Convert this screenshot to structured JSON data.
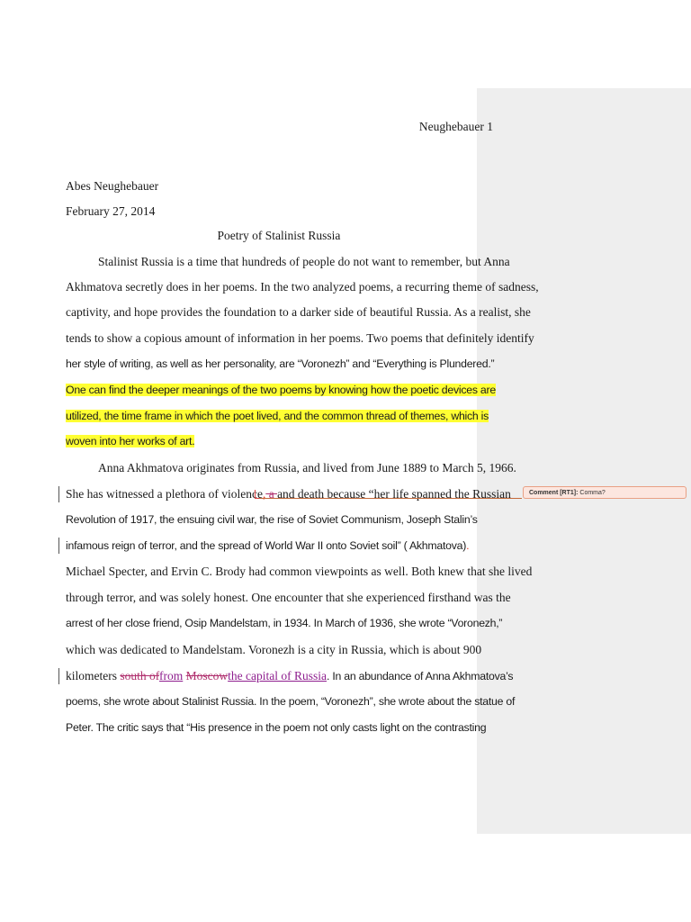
{
  "header": {
    "page_number": "Neughebauer 1"
  },
  "author": "Abes Neughebauer",
  "date": "February 27, 2014",
  "title": "Poetry of Stalinist Russia",
  "p1": {
    "l1": "Stalinist Russia is a time that hundreds of people do not want to remember, but Anna",
    "l2": "Akhmatova secretly does in her poems. In the two analyzed poems, a recurring theme of sadness,",
    "l3": "captivity, and hope provides the foundation to a darker side of beautiful Russia. As a realist, she",
    "l4": "tends to show a copious amount of information in her poems. Two poems that definitely identify",
    "l5": "her style of writing, as well as her personality, are “Voronezh” and “Everything is Plundered.”",
    "l6": "One can find the deeper meanings of the two poems by knowing how the poetic devices are",
    "l7": "utilized, the time frame in which the poet lived, and the common thread of themes, which is",
    "l8": "woven into her works of art."
  },
  "p2": {
    "l1": "Anna Akhmatova originates from Russia, and lived from June 1889 to March 5, 1966.",
    "l2a": "She has witnessed a plethora of violence",
    "l2_mark1": ",",
    "l2_del": " a ",
    "l2b": "and death because “her life spanned the Russian",
    "l3": "Revolution of 1917,  the ensuing civil war, the rise of Soviet Communism, Joseph Stalin’s",
    "l4a": "infamous reign of terror, and the spread of World War II onto Soviet soil” ( Akhmatova)",
    "l4_mark": ".",
    "l5": "Michael Specter, and Ervin C. Brody had common viewpoints as well. Both knew that she lived",
    "l6": "through terror, and was solely honest. One encounter that she experienced firsthand was the",
    "l7": "arrest of her close friend, Osip Mandelstam, in 1934. In March of 1936, she wrote “Voronezh,”",
    "l8": "which was dedicated to Mandelstam.  Voronezh is a city in Russia, which is about 900",
    "l9a": "kilometers ",
    "l9_del1": "south of",
    "l9_ins1": "from",
    "l9_space": " ",
    "l9_del2": "Moscow",
    "l9_ins2": "the capital of Russia",
    "l9b": ". In an abundance of Anna Akhmatova’s",
    "l10": "poems, she wrote about Stalinist Russia. In the poem, “Voronezh”, she wrote about the statue of",
    "l11": "Peter. The critic says that “His presence in the poem not only casts light on the contrasting"
  },
  "comment": {
    "label": "Comment [RT1]:",
    "text": "Comma?"
  },
  "colors": {
    "highlight": "#ffff33",
    "deletion": "#b0306e",
    "insertion": "#8e1e8e",
    "comment_bg": "#fce6df"
  }
}
